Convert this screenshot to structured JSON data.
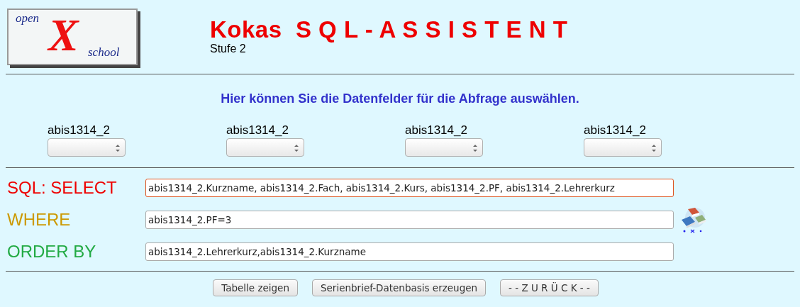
{
  "logo": {
    "top": "open",
    "mark": "X",
    "bottom": "school"
  },
  "header": {
    "title": "Kokas  S Q L - A S S I S T E N T",
    "subtitle": "Stufe 2"
  },
  "instruction": "Hier können Sie die Datenfelder für die Abfrage auswählen.",
  "field_pickers": [
    {
      "label": "abis1314_2"
    },
    {
      "label": "abis1314_2"
    },
    {
      "label": "abis1314_2"
    },
    {
      "label": "abis1314_2"
    }
  ],
  "clauses": [
    {
      "label": "SQL: SELECT",
      "color": "#ee0000",
      "value": "abis1314_2.Kurzname, abis1314_2.Fach, abis1314_2.Kurs, abis1314_2.PF, abis1314_2.Lehrerkurz",
      "focused": true
    },
    {
      "label": "WHERE",
      "color": "#cc9900",
      "value": "abis1314_2.PF=3",
      "focused": false
    },
    {
      "label": "ORDER BY",
      "color": "#22aa44",
      "value": "abis1314_2.Lehrerkurz,abis1314_2.Kurzname",
      "focused": false
    }
  ],
  "buttons": [
    "Tabelle zeigen",
    "Serienbrief-Datenbasis erzeugen",
    "- - Z U R Ü C K - -"
  ]
}
